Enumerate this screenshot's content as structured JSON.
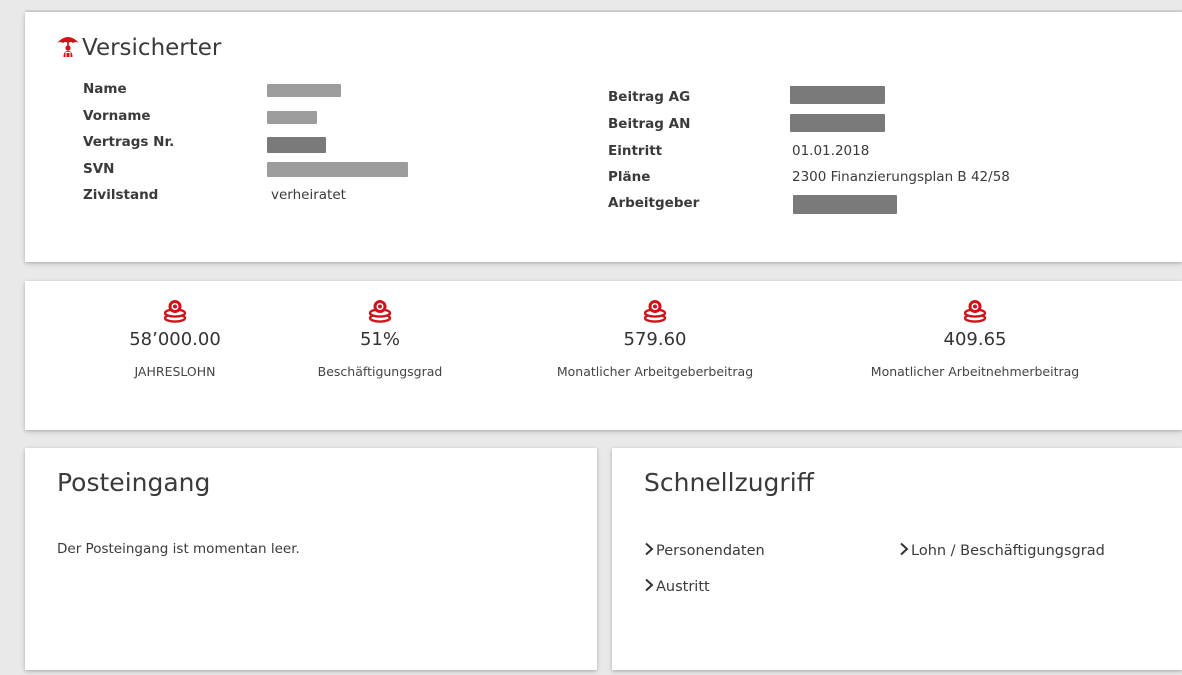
{
  "versicherter": {
    "title": "Versicherter",
    "icon": "umbrella-person-icon",
    "left_fields": [
      {
        "label": "Name",
        "value": null
      },
      {
        "label": "Vorname",
        "value": null
      },
      {
        "label": "Vertrags Nr.",
        "value": null
      },
      {
        "label": "SVN",
        "value": null
      },
      {
        "label": "Zivilstand",
        "value": "verheiratet"
      }
    ],
    "right_fields": [
      {
        "label": "Beitrag AG",
        "value": null
      },
      {
        "label": "Beitrag AN",
        "value": null
      },
      {
        "label": "Eintritt",
        "value": "01.01.2018"
      },
      {
        "label": "Pläne",
        "value": "2300 Finanzierungsplan B 42/58"
      },
      {
        "label": "Arbeitgeber",
        "value": null
      }
    ]
  },
  "kpis": [
    {
      "value": "58’000.00",
      "label": "JAHRESLOHN",
      "icon": "coins-icon"
    },
    {
      "value": "51%",
      "label": "Beschäftigungsgrad",
      "icon": "coins-icon"
    },
    {
      "value": "579.60",
      "label": "Monatlicher Arbeitgeberbeitrag",
      "icon": "coins-icon"
    },
    {
      "value": "409.65",
      "label": "Monatlicher Arbeitnehmerbeitrag",
      "icon": "coins-icon"
    }
  ],
  "posteingang": {
    "title": "Posteingang",
    "empty_text": "Der Posteingang ist momentan leer."
  },
  "schnellzugriff": {
    "title": "Schnellzugriff",
    "links": [
      {
        "label": "Personendaten"
      },
      {
        "label": "Lohn / Beschäftigungsgrad"
      },
      {
        "label": "Austritt"
      }
    ]
  },
  "colors": {
    "accent": "#d0121b",
    "redaction": "#9d9d9d"
  }
}
